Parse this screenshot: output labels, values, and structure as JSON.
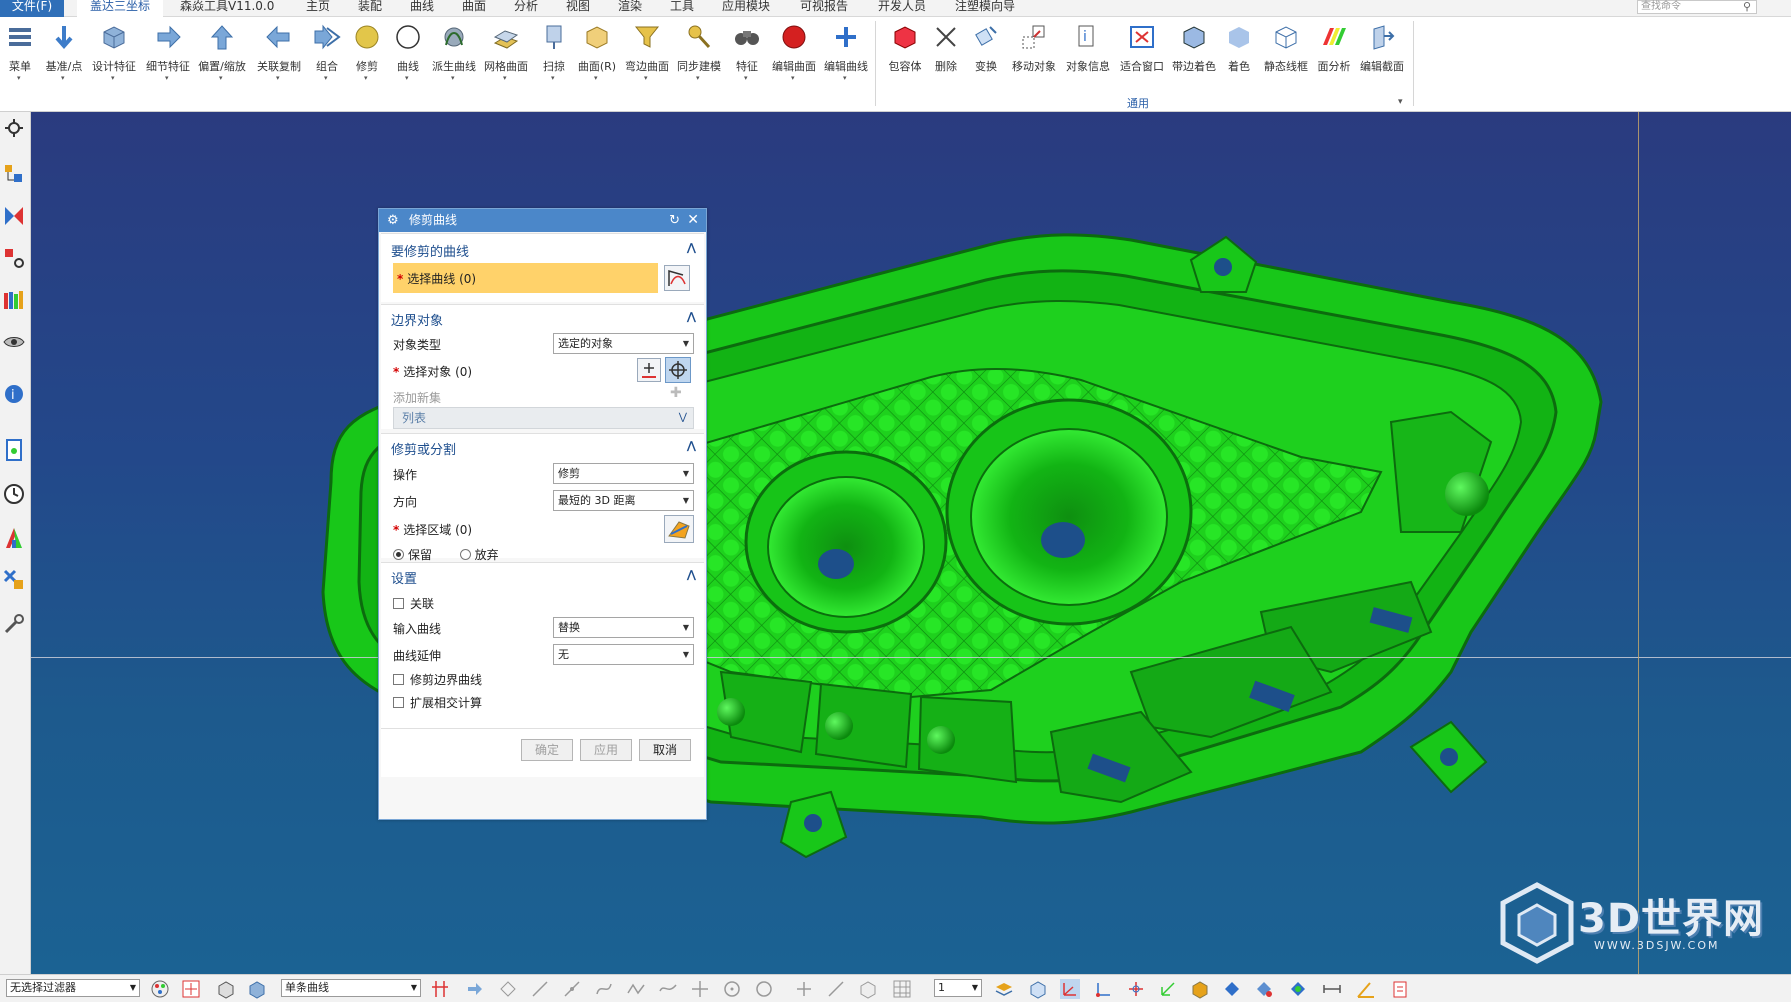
{
  "menubar": {
    "tabs": [
      "文件(F)",
      "盖达三坐标",
      "森焱工具V11.0.0",
      "主页",
      "装配",
      "曲线",
      "曲面",
      "分析",
      "视图",
      "渲染",
      "工具",
      "应用模块",
      "可视报告",
      "开发人员",
      "注塑模向导"
    ],
    "search_placeholder": "查找命令"
  },
  "ribbon": {
    "buttons": [
      "菜单",
      "基准/点",
      "设计特征",
      "细节特征",
      "偏置/缩放",
      "关联复制",
      "组合",
      "修剪",
      "曲线",
      "派生曲线",
      "网格曲面",
      "扫掠",
      "曲面(R)",
      "弯边曲面",
      "同步建模",
      "特征",
      "编辑曲面",
      "编辑曲线",
      "包容体",
      "删除",
      "变换",
      "移动对象",
      "对象信息",
      "适合窗口",
      "带边着色",
      "着色",
      "静态线框",
      "面分析",
      "编辑截面"
    ],
    "group_label": "通用"
  },
  "dialog": {
    "title": "修剪曲线",
    "sections": {
      "curve_to_trim": {
        "header": "要修剪的曲线",
        "select_curve": "选择曲线 (0)"
      },
      "boundary": {
        "header": "边界对象",
        "object_type_label": "对象类型",
        "object_type_value": "选定的对象",
        "select_object": "选择对象 (0)",
        "add_new_set": "添加新集",
        "list": "列表"
      },
      "trim_or_split": {
        "header": "修剪或分割",
        "operation_label": "操作",
        "operation_value": "修剪",
        "direction_label": "方向",
        "direction_value": "最短的 3D 距离",
        "select_region": "选择区域 (0)",
        "keep": "保留",
        "discard": "放弃"
      },
      "settings": {
        "header": "设置",
        "associative": "关联",
        "input_curve_label": "输入曲线",
        "input_curve_value": "替换",
        "extension_label": "曲线延伸",
        "extension_value": "无",
        "trim_boundary_curve": "修剪边界曲线",
        "extended_intersection": "扩展相交计算"
      }
    },
    "buttons": {
      "ok": "确定",
      "apply": "应用",
      "cancel": "取消"
    }
  },
  "statusbar": {
    "filter_value": "无选择过滤器",
    "curve_rule_value": "单条曲线",
    "scale_value": "1"
  },
  "watermark": {
    "text": "3D世界网",
    "url": "WWW.3DSJW.COM"
  },
  "colors": {
    "part_green": "#19d41a",
    "part_dark": "#0f7f12",
    "viewport_top": "#2a3b7f",
    "viewport_bottom": "#1b6293",
    "dialog_title": "#4b87c9",
    "highlight": "#ffd26a"
  }
}
